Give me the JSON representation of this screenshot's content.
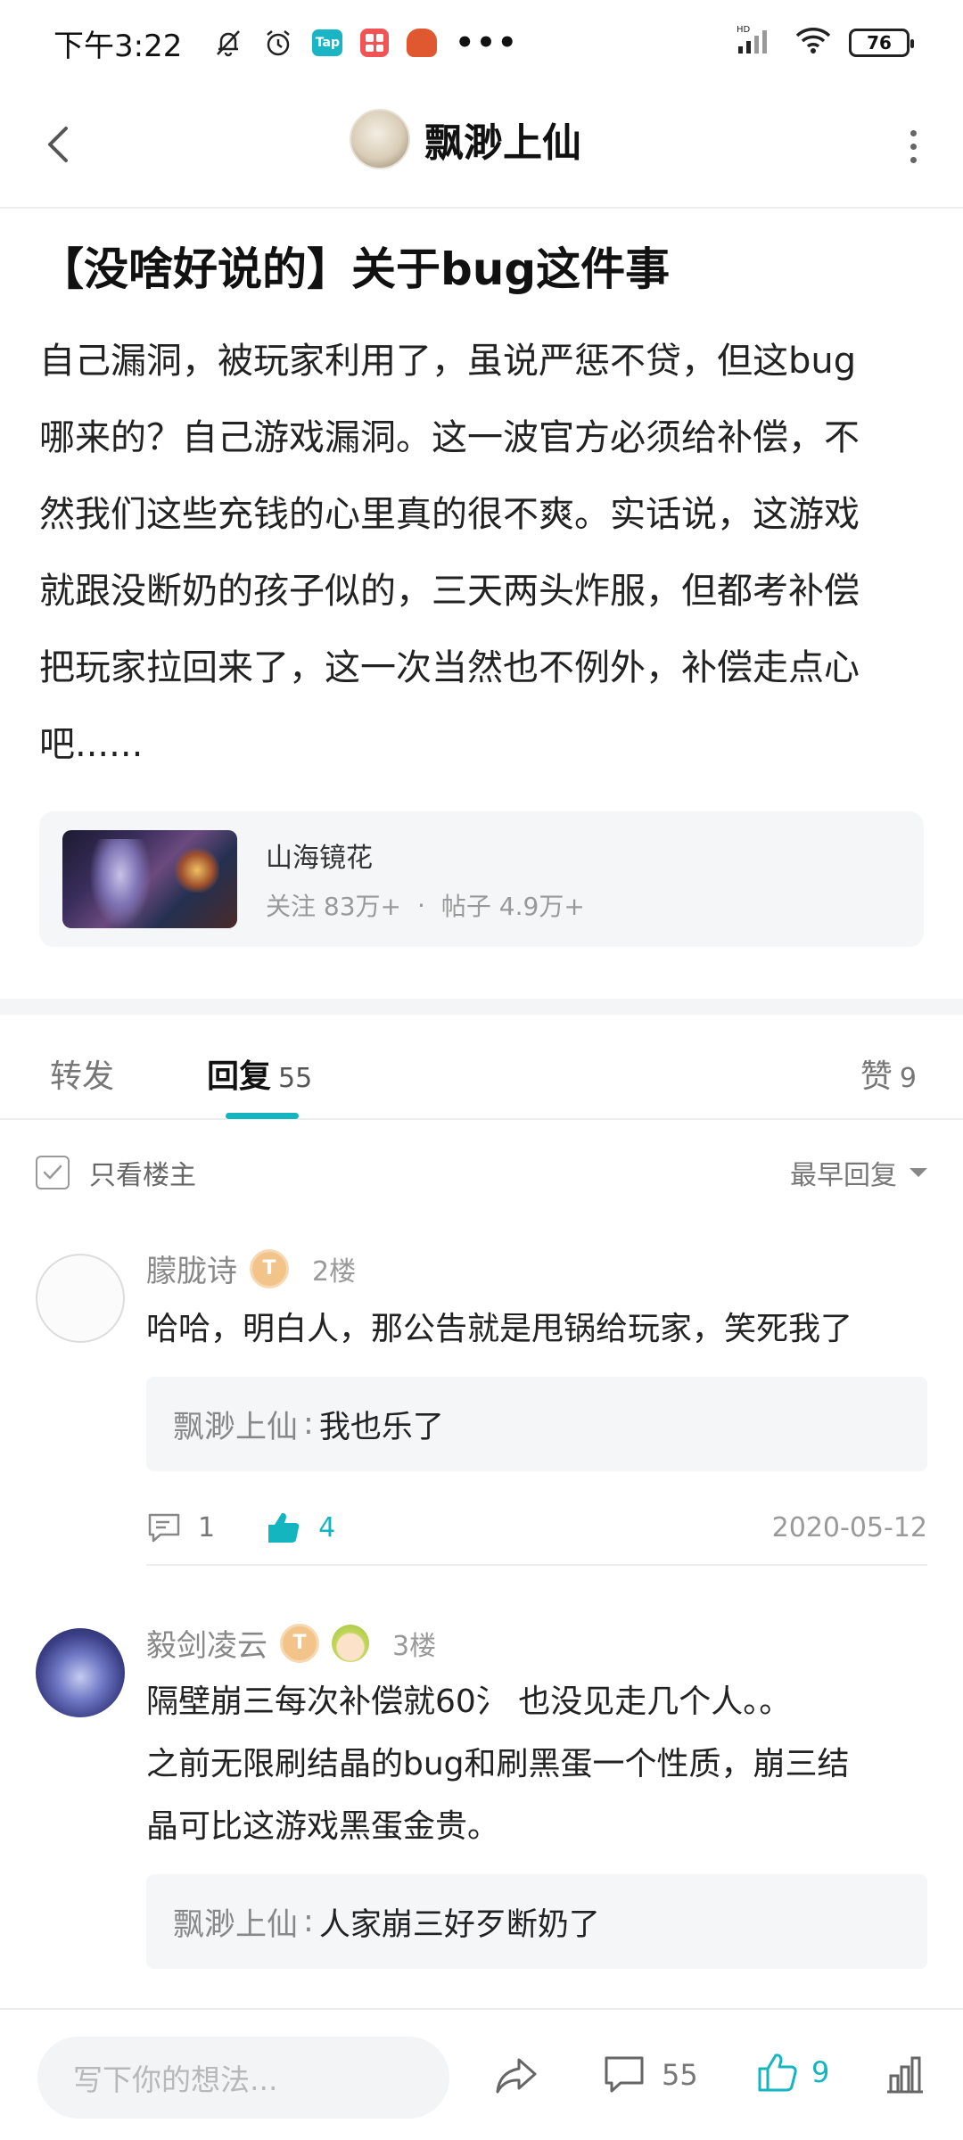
{
  "status_bar": {
    "time": "下午3:22",
    "tap_label": "Tap",
    "network": "HD",
    "battery": "76"
  },
  "header": {
    "title": "飘渺上仙"
  },
  "post": {
    "title": "【没啥好说的】关于bug这件事",
    "body_lines": [
      "自己漏洞，被玩家利用了，虽说严惩不贷，但这bug",
      "哪来的？自己游戏漏洞。这一波官方必须给补偿，不",
      "然我们这些充钱的心里真的很不爽。实话说，这游戏",
      "就跟没断奶的孩子似的，三天两头炸服，但都考补偿",
      "把玩家拉回来了，这一次当然也不例外，补偿走点心",
      "吧......"
    ]
  },
  "forum": {
    "name": "山海镜花",
    "follow_label": "关注 83万+",
    "dot": "·",
    "posts_label": "帖子 4.9万+"
  },
  "tabs": {
    "forward": "转发",
    "reply": "回复",
    "reply_count": "55",
    "like": "赞",
    "like_count": "9"
  },
  "filter": {
    "only_author": "只看楼主",
    "sort": "最早回复"
  },
  "comments": [
    {
      "name": "朦胧诗",
      "badge": "T",
      "floor": "2楼",
      "text_lines": [
        "哈哈，明白人，那公告就是甩锅给玩家，笑死我了"
      ],
      "reply_name": "飘渺上仙",
      "reply_sep": ":",
      "reply_text": "我也乐了",
      "comment_count": "1",
      "like_count": "4",
      "date": "2020-05-12"
    },
    {
      "name": "毅剑凌云",
      "badge": "T",
      "floor": "3楼",
      "text_lines": [
        "隔壁崩三每次补偿就60氵 也没见走几个人。。",
        "之前无限刷结晶的bug和刷黑蛋一个性质，崩三结",
        "晶可比这游戏黑蛋金贵。"
      ],
      "reply_name": "飘渺上仙",
      "reply_sep": ":",
      "reply_text": "人家崩三好歹断奶了"
    }
  ],
  "bottom_bar": {
    "placeholder": "写下你的想法...",
    "comment_count": "55",
    "like_count": "9"
  },
  "colors": {
    "accent": "#15b5c0",
    "badge": "#f2c48a"
  }
}
